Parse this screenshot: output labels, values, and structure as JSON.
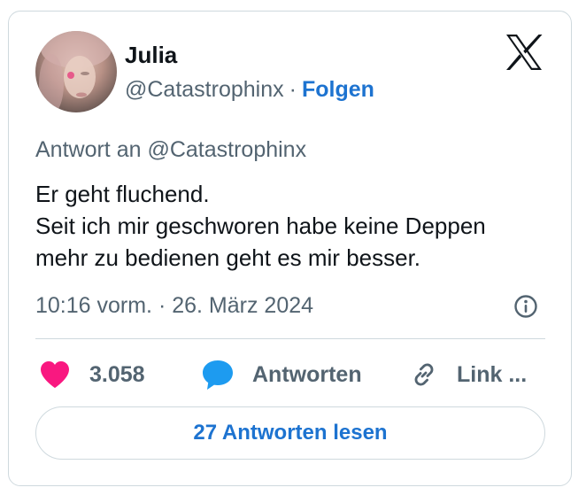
{
  "author": {
    "name": "Julia",
    "handle": "@Catastrophinx",
    "separator": "·",
    "follow_label": "Folgen"
  },
  "icons": {
    "platform_logo": "x-logo-icon",
    "info": "info-icon",
    "like": "heart-icon",
    "reply": "speech-bubble-icon",
    "link": "link-icon"
  },
  "tweet": {
    "reply_to": "Antwort an @Catastrophinx",
    "text_lines": [
      "Er geht fluchend.",
      "Seit ich mir geschworen habe keine Deppen",
      "mehr zu bedienen geht es mir besser."
    ],
    "timestamp": "10:16 vorm. · 26. März 2024"
  },
  "actions": {
    "like_count": "3.058",
    "reply_label": "Antworten",
    "link_label": "Link ..."
  },
  "read_replies_label": "27 Antworten lesen",
  "colors": {
    "accent": "#1d73d0",
    "heart": "#f91880",
    "reply_bubble": "#1d9bf0",
    "secondary_text": "#536471",
    "border": "#cfd9de"
  }
}
